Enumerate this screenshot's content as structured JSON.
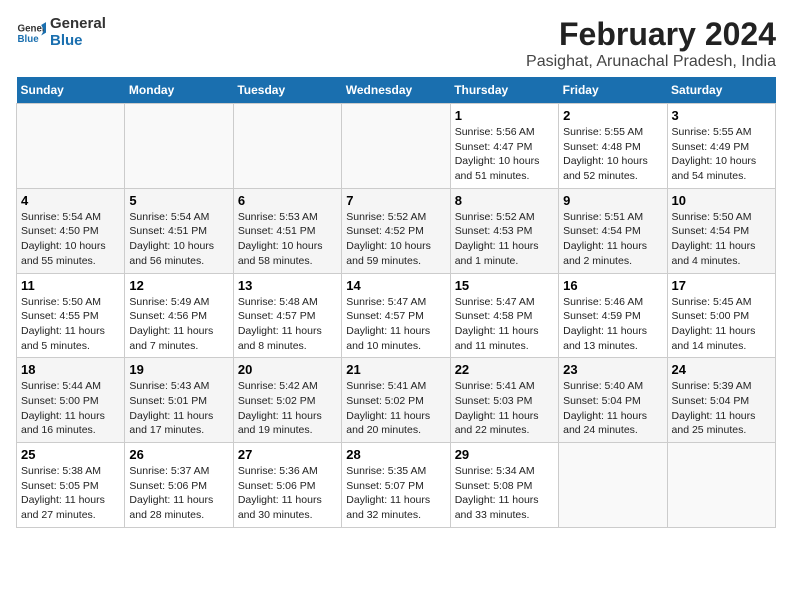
{
  "logo": {
    "line1": "General",
    "line2": "Blue"
  },
  "title": "February 2024",
  "subtitle": "Pasighat, Arunachal Pradesh, India",
  "days_of_week": [
    "Sunday",
    "Monday",
    "Tuesday",
    "Wednesday",
    "Thursday",
    "Friday",
    "Saturday"
  ],
  "weeks": [
    [
      {
        "num": "",
        "info": ""
      },
      {
        "num": "",
        "info": ""
      },
      {
        "num": "",
        "info": ""
      },
      {
        "num": "",
        "info": ""
      },
      {
        "num": "1",
        "info": "Sunrise: 5:56 AM\nSunset: 4:47 PM\nDaylight: 10 hours\nand 51 minutes."
      },
      {
        "num": "2",
        "info": "Sunrise: 5:55 AM\nSunset: 4:48 PM\nDaylight: 10 hours\nand 52 minutes."
      },
      {
        "num": "3",
        "info": "Sunrise: 5:55 AM\nSunset: 4:49 PM\nDaylight: 10 hours\nand 54 minutes."
      }
    ],
    [
      {
        "num": "4",
        "info": "Sunrise: 5:54 AM\nSunset: 4:50 PM\nDaylight: 10 hours\nand 55 minutes."
      },
      {
        "num": "5",
        "info": "Sunrise: 5:54 AM\nSunset: 4:51 PM\nDaylight: 10 hours\nand 56 minutes."
      },
      {
        "num": "6",
        "info": "Sunrise: 5:53 AM\nSunset: 4:51 PM\nDaylight: 10 hours\nand 58 minutes."
      },
      {
        "num": "7",
        "info": "Sunrise: 5:52 AM\nSunset: 4:52 PM\nDaylight: 10 hours\nand 59 minutes."
      },
      {
        "num": "8",
        "info": "Sunrise: 5:52 AM\nSunset: 4:53 PM\nDaylight: 11 hours\nand 1 minute."
      },
      {
        "num": "9",
        "info": "Sunrise: 5:51 AM\nSunset: 4:54 PM\nDaylight: 11 hours\nand 2 minutes."
      },
      {
        "num": "10",
        "info": "Sunrise: 5:50 AM\nSunset: 4:54 PM\nDaylight: 11 hours\nand 4 minutes."
      }
    ],
    [
      {
        "num": "11",
        "info": "Sunrise: 5:50 AM\nSunset: 4:55 PM\nDaylight: 11 hours\nand 5 minutes."
      },
      {
        "num": "12",
        "info": "Sunrise: 5:49 AM\nSunset: 4:56 PM\nDaylight: 11 hours\nand 7 minutes."
      },
      {
        "num": "13",
        "info": "Sunrise: 5:48 AM\nSunset: 4:57 PM\nDaylight: 11 hours\nand 8 minutes."
      },
      {
        "num": "14",
        "info": "Sunrise: 5:47 AM\nSunset: 4:57 PM\nDaylight: 11 hours\nand 10 minutes."
      },
      {
        "num": "15",
        "info": "Sunrise: 5:47 AM\nSunset: 4:58 PM\nDaylight: 11 hours\nand 11 minutes."
      },
      {
        "num": "16",
        "info": "Sunrise: 5:46 AM\nSunset: 4:59 PM\nDaylight: 11 hours\nand 13 minutes."
      },
      {
        "num": "17",
        "info": "Sunrise: 5:45 AM\nSunset: 5:00 PM\nDaylight: 11 hours\nand 14 minutes."
      }
    ],
    [
      {
        "num": "18",
        "info": "Sunrise: 5:44 AM\nSunset: 5:00 PM\nDaylight: 11 hours\nand 16 minutes."
      },
      {
        "num": "19",
        "info": "Sunrise: 5:43 AM\nSunset: 5:01 PM\nDaylight: 11 hours\nand 17 minutes."
      },
      {
        "num": "20",
        "info": "Sunrise: 5:42 AM\nSunset: 5:02 PM\nDaylight: 11 hours\nand 19 minutes."
      },
      {
        "num": "21",
        "info": "Sunrise: 5:41 AM\nSunset: 5:02 PM\nDaylight: 11 hours\nand 20 minutes."
      },
      {
        "num": "22",
        "info": "Sunrise: 5:41 AM\nSunset: 5:03 PM\nDaylight: 11 hours\nand 22 minutes."
      },
      {
        "num": "23",
        "info": "Sunrise: 5:40 AM\nSunset: 5:04 PM\nDaylight: 11 hours\nand 24 minutes."
      },
      {
        "num": "24",
        "info": "Sunrise: 5:39 AM\nSunset: 5:04 PM\nDaylight: 11 hours\nand 25 minutes."
      }
    ],
    [
      {
        "num": "25",
        "info": "Sunrise: 5:38 AM\nSunset: 5:05 PM\nDaylight: 11 hours\nand 27 minutes."
      },
      {
        "num": "26",
        "info": "Sunrise: 5:37 AM\nSunset: 5:06 PM\nDaylight: 11 hours\nand 28 minutes."
      },
      {
        "num": "27",
        "info": "Sunrise: 5:36 AM\nSunset: 5:06 PM\nDaylight: 11 hours\nand 30 minutes."
      },
      {
        "num": "28",
        "info": "Sunrise: 5:35 AM\nSunset: 5:07 PM\nDaylight: 11 hours\nand 32 minutes."
      },
      {
        "num": "29",
        "info": "Sunrise: 5:34 AM\nSunset: 5:08 PM\nDaylight: 11 hours\nand 33 minutes."
      },
      {
        "num": "",
        "info": ""
      },
      {
        "num": "",
        "info": ""
      }
    ]
  ]
}
